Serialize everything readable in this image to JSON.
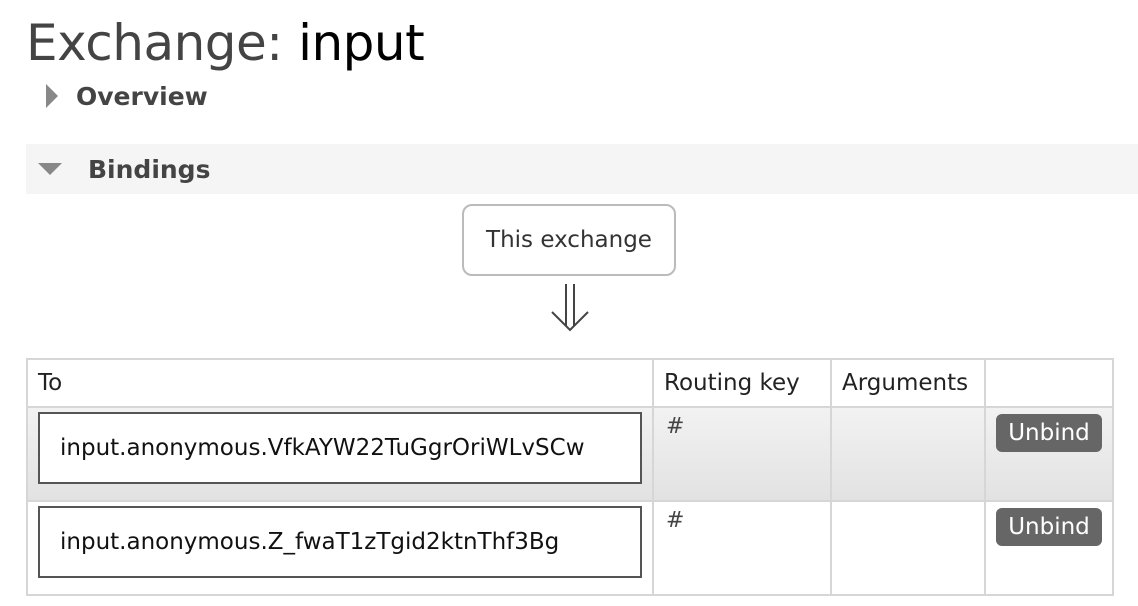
{
  "page": {
    "title_prefix": "Exchange: ",
    "title_name": "input"
  },
  "sections": {
    "overview_label": "Overview",
    "bindings_label": "Bindings"
  },
  "source": {
    "label": "This exchange"
  },
  "table": {
    "headers": [
      "To",
      "Routing key",
      "Arguments",
      ""
    ],
    "rows": [
      {
        "to": "input.anonymous.VfkAYW22TuGgrOriWLvSCw",
        "routing_key": "#",
        "arguments": "",
        "action": "Unbind"
      },
      {
        "to": "input.anonymous.Z_fwaT1zTgid2ktnThf3Bg",
        "routing_key": "#",
        "arguments": "",
        "action": "Unbind"
      }
    ]
  },
  "icons": {
    "overview_toggle": "triangle-right-icon",
    "bindings_toggle": "triangle-down-icon",
    "flow_arrow": "double-arrow-down-icon"
  },
  "colors": {
    "button_bg": "#666666",
    "section_bg": "#f5f5f5",
    "border": "#d6d6d6"
  }
}
